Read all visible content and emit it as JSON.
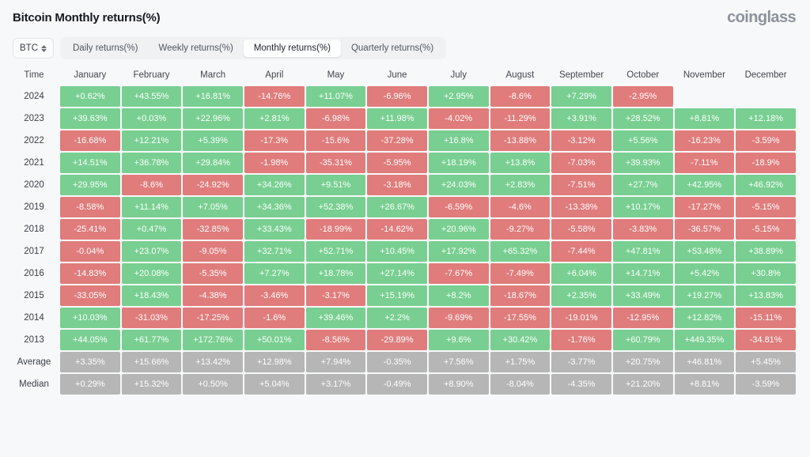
{
  "header": {
    "title": "Bitcoin Monthly returns(%)",
    "brand": "coinglass"
  },
  "controls": {
    "symbol": "BTC",
    "symbol_icon": "chevron-up-down-icon",
    "tabs": [
      {
        "label": "Daily returns(%)",
        "active": false
      },
      {
        "label": "Weekly returns(%)",
        "active": false
      },
      {
        "label": "Monthly returns(%)",
        "active": true
      },
      {
        "label": "Quarterly returns(%)",
        "active": false
      }
    ]
  },
  "colors": {
    "positive": "#78cf91",
    "negative": "#e07c7c",
    "stat": "#b6b6b6",
    "background": "#f7f8f9",
    "brand": "#8c929b"
  },
  "chart_data": {
    "type": "heatmap",
    "title": "Bitcoin Monthly returns(%)",
    "xlabel": "",
    "ylabel": "Time",
    "columns": [
      "Time",
      "January",
      "February",
      "March",
      "April",
      "May",
      "June",
      "July",
      "August",
      "September",
      "October",
      "November",
      "December"
    ],
    "rows": [
      {
        "label": "2024",
        "kind": "year",
        "values": [
          "+0.62%",
          "+43.55%",
          "+16.81%",
          "-14.76%",
          "+11.07%",
          "-6.96%",
          "+2.95%",
          "-8.6%",
          "+7.29%",
          "-2.95%",
          "",
          ""
        ]
      },
      {
        "label": "2023",
        "kind": "year",
        "values": [
          "+39.63%",
          "+0.03%",
          "+22.96%",
          "+2.81%",
          "-6.98%",
          "+11.98%",
          "-4.02%",
          "-11.29%",
          "+3.91%",
          "+28.52%",
          "+8.81%",
          "+12.18%"
        ]
      },
      {
        "label": "2022",
        "kind": "year",
        "values": [
          "-16.68%",
          "+12.21%",
          "+5.39%",
          "-17.3%",
          "-15.6%",
          "-37.28%",
          "+16.8%",
          "-13.88%",
          "-3.12%",
          "+5.56%",
          "-16.23%",
          "-3.59%"
        ]
      },
      {
        "label": "2021",
        "kind": "year",
        "values": [
          "+14.51%",
          "+36.78%",
          "+29.84%",
          "-1.98%",
          "-35.31%",
          "-5.95%",
          "+18.19%",
          "+13.8%",
          "-7.03%",
          "+39.93%",
          "-7.11%",
          "-18.9%"
        ]
      },
      {
        "label": "2020",
        "kind": "year",
        "values": [
          "+29.95%",
          "-8.6%",
          "-24.92%",
          "+34.26%",
          "+9.51%",
          "-3.18%",
          "+24.03%",
          "+2.83%",
          "-7.51%",
          "+27.7%",
          "+42.95%",
          "+46.92%"
        ]
      },
      {
        "label": "2019",
        "kind": "year",
        "values": [
          "-8.58%",
          "+11.14%",
          "+7.05%",
          "+34.36%",
          "+52.38%",
          "+26.67%",
          "-6.59%",
          "-4.6%",
          "-13.38%",
          "+10.17%",
          "-17.27%",
          "-5.15%"
        ]
      },
      {
        "label": "2018",
        "kind": "year",
        "values": [
          "-25.41%",
          "+0.47%",
          "-32.85%",
          "+33.43%",
          "-18.99%",
          "-14.62%",
          "+20.96%",
          "-9.27%",
          "-5.58%",
          "-3.83%",
          "-36.57%",
          "-5.15%"
        ]
      },
      {
        "label": "2017",
        "kind": "year",
        "values": [
          "-0.04%",
          "+23.07%",
          "-9.05%",
          "+32.71%",
          "+52.71%",
          "+10.45%",
          "+17.92%",
          "+65.32%",
          "-7.44%",
          "+47.81%",
          "+53.48%",
          "+38.89%"
        ]
      },
      {
        "label": "2016",
        "kind": "year",
        "values": [
          "-14.83%",
          "+20.08%",
          "-5.35%",
          "+7.27%",
          "+18.78%",
          "+27.14%",
          "-7.67%",
          "-7.49%",
          "+6.04%",
          "+14.71%",
          "+5.42%",
          "+30.8%"
        ]
      },
      {
        "label": "2015",
        "kind": "year",
        "values": [
          "-33.05%",
          "+18.43%",
          "-4.38%",
          "-3.46%",
          "-3.17%",
          "+15.19%",
          "+8.2%",
          "-18.67%",
          "+2.35%",
          "+33.49%",
          "+19.27%",
          "+13.83%"
        ]
      },
      {
        "label": "2014",
        "kind": "year",
        "values": [
          "+10.03%",
          "-31.03%",
          "-17.25%",
          "-1.6%",
          "+39.46%",
          "+2.2%",
          "-9.69%",
          "-17.55%",
          "-19.01%",
          "-12.95%",
          "+12.82%",
          "-15.11%"
        ]
      },
      {
        "label": "2013",
        "kind": "year",
        "values": [
          "+44.05%",
          "+61.77%",
          "+172.76%",
          "+50.01%",
          "-8.56%",
          "-29.89%",
          "+9.6%",
          "+30.42%",
          "-1.76%",
          "+60.79%",
          "+449.35%",
          "-34.81%"
        ]
      },
      {
        "label": "Average",
        "kind": "stat",
        "values": [
          "+3.35%",
          "+15.66%",
          "+13.42%",
          "+12.98%",
          "+7.94%",
          "-0.35%",
          "+7.56%",
          "+1.75%",
          "-3.77%",
          "+20.75%",
          "+46.81%",
          "+5.45%"
        ]
      },
      {
        "label": "Median",
        "kind": "stat",
        "values": [
          "+0.29%",
          "+15.32%",
          "+0.50%",
          "+5.04%",
          "+3.17%",
          "-0.49%",
          "+8.90%",
          "-8.04%",
          "-4.35%",
          "+21.20%",
          "+8.81%",
          "-3.59%"
        ]
      }
    ]
  }
}
